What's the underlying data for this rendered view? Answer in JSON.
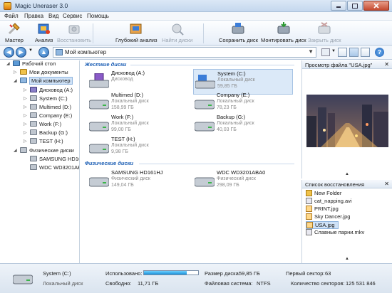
{
  "window": {
    "title": "Magic Uneraser 3.0"
  },
  "menu": [
    "Файл",
    "Правка",
    "Вид",
    "Сервис",
    "Помощь"
  ],
  "toolbar": {
    "wizard": "Мастер",
    "analyze": "Анализ",
    "restore": "Восстановить",
    "deep": "Глубокий анализ",
    "find": "Найти диски",
    "save_disk": "Сохранить диск",
    "mount": "Монтировать диск",
    "close_disk": "Закрыть диск"
  },
  "address": {
    "value": "Мой компьютер"
  },
  "tree": [
    {
      "label": "Рабочий стол",
      "icon": "desktop-icon"
    },
    {
      "label": "Мои документы",
      "icon": "folder-icon"
    },
    {
      "label": "Мой компьютер",
      "icon": "computer-icon"
    },
    {
      "label": "Дисковод (A:)",
      "icon": "floppy-icon"
    },
    {
      "label": "System (C:)",
      "icon": "drive-icon"
    },
    {
      "label": "Multimed (D:)",
      "icon": "drive-icon"
    },
    {
      "label": "Company (E:)",
      "icon": "drive-icon"
    },
    {
      "label": "Work (F:)",
      "icon": "drive-icon"
    },
    {
      "label": "Backup (G:)",
      "icon": "drive-icon"
    },
    {
      "label": "TEST (H:)",
      "icon": "drive-icon"
    },
    {
      "label": "Физические диски",
      "icon": "drive-icon"
    },
    {
      "label": "SAMSUNG HD16",
      "icon": "drive-icon"
    },
    {
      "label": "WDC WD3201AB",
      "icon": "drive-icon"
    }
  ],
  "sections": {
    "hard": "Жесткие диски",
    "physical": "Физические диски"
  },
  "drives": [
    {
      "name": "Дисковод (A:)",
      "type": "Дисковод",
      "size": ""
    },
    {
      "name": "System (C:)",
      "type": "Локальный диск",
      "size": "59,85 ГБ"
    },
    {
      "name": "Multimed (D:)",
      "type": "Локальный диск",
      "size": "158,99 ГБ"
    },
    {
      "name": "Company (E:)",
      "type": "Локальный диск",
      "size": "78,23 ГБ"
    },
    {
      "name": "Work (F:)",
      "type": "Локальный диск",
      "size": "99,00 ГБ"
    },
    {
      "name": "Backup (G:)",
      "type": "Локальный диск",
      "size": "40,03 ГБ"
    },
    {
      "name": "TEST (H:)",
      "type": "Локальный диск",
      "size": "9,98 ГБ"
    }
  ],
  "physical": [
    {
      "name": "SAMSUNG HD161HJ",
      "type": "Физический диск",
      "size": "149,04 ГБ"
    },
    {
      "name": "WDC WD3201ABA0",
      "type": "Физический диск",
      "size": "298,09 ГБ"
    }
  ],
  "preview": {
    "title": "Просмотр файла \"USA.jpg\""
  },
  "recovery": {
    "title": "Список восстановления",
    "items": [
      "New Folder",
      "cat_napping.avi",
      "PRINT.jpg",
      "Sky Dancer.jpg",
      "USA.jpg",
      "Славные парни.mkv"
    ]
  },
  "status": {
    "drive": "System (C:)",
    "type": "Локальный диск",
    "used_label": "Использовано:",
    "used_fraction": 0.79,
    "free_label": "Свободно:",
    "free_value": "11,71 ГБ",
    "size_label": "Размер диска:",
    "size_value": "59,85 ГБ",
    "fs_label": "Файловая система:",
    "fs_value": "NTFS",
    "first_label": "Первый сектор:",
    "first_value": "63",
    "count_label": "Количество секторов:",
    "count_value": "125 531 846"
  }
}
